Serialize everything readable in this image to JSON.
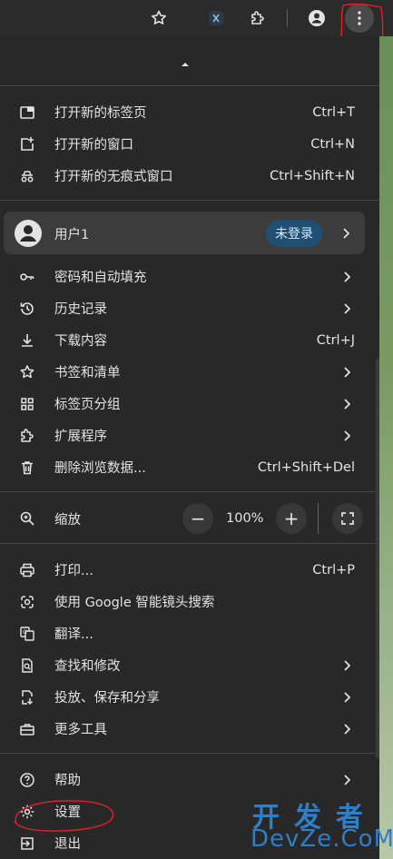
{
  "toolbar": {
    "buttons": [
      "bookmark-star",
      "extension-x",
      "extensions",
      "profile",
      "chrome-menu"
    ]
  },
  "menu": {
    "section1": [
      {
        "label": "打开新的标签页",
        "shortcut": "Ctrl+T",
        "icon": "new-tab-icon"
      },
      {
        "label": "打开新的窗口",
        "shortcut": "Ctrl+N",
        "icon": "new-window-icon"
      },
      {
        "label": "打开新的无痕式窗口",
        "shortcut": "Ctrl+Shift+N",
        "icon": "incognito-icon"
      }
    ],
    "profile": {
      "label": "用户1",
      "badge": "未登录"
    },
    "section2": [
      {
        "label": "密码和自动填充",
        "icon": "key-icon",
        "submenu": true
      },
      {
        "label": "历史记录",
        "icon": "history-icon",
        "submenu": true
      },
      {
        "label": "下载内容",
        "shortcut": "Ctrl+J",
        "icon": "download-icon"
      },
      {
        "label": "书签和清单",
        "icon": "star-icon",
        "submenu": true
      },
      {
        "label": "标签页分组",
        "icon": "grid-icon",
        "submenu": true
      },
      {
        "label": "扩展程序",
        "icon": "puzzle-icon",
        "submenu": true
      },
      {
        "label": "删除浏览数据...",
        "shortcut": "Ctrl+Shift+Del",
        "icon": "trash-icon"
      }
    ],
    "zoom": {
      "label": "缩放",
      "minus": "−",
      "value": "100%",
      "plus": "+"
    },
    "section3": [
      {
        "label": "打印...",
        "shortcut": "Ctrl+P",
        "icon": "print-icon"
      },
      {
        "label": "使用 Google 智能镜头搜索",
        "icon": "lens-icon"
      },
      {
        "label": "翻译...",
        "icon": "translate-icon"
      },
      {
        "label": "查找和修改",
        "icon": "find-icon",
        "submenu": true
      },
      {
        "label": "投放、保存和分享",
        "icon": "cast-icon",
        "submenu": true
      },
      {
        "label": "更多工具",
        "icon": "toolbox-icon",
        "submenu": true
      }
    ],
    "section4": [
      {
        "label": "帮助",
        "icon": "help-icon",
        "submenu": true
      },
      {
        "label": "设置",
        "icon": "settings-icon"
      },
      {
        "label": "退出",
        "icon": "exit-icon"
      }
    ]
  },
  "watermark": {
    "line1": "开发者",
    "line2": "DevZe.CoM"
  },
  "colors": {
    "menu_bg": "#282828",
    "toolbar_bg": "#2b2b2b",
    "badge_bg": "#1f4f73",
    "annotation": "#e0202a"
  }
}
